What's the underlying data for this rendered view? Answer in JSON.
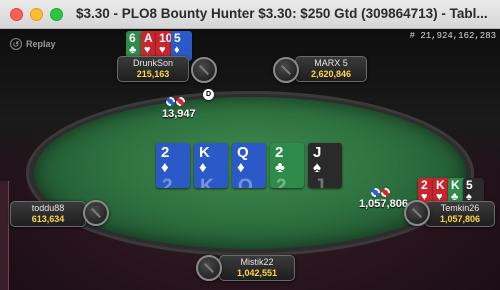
{
  "window": {
    "title": "$3.30 - PLO8 Bounty Hunter $3.30: $250 Gtd  (309864713) - Tabl..."
  },
  "toolbar": {
    "replay_label": "Replay",
    "hand_id": "# 21,924,162,283"
  },
  "players": {
    "top_left": {
      "name": "DrunkSon",
      "stack": "215,163"
    },
    "top_right": {
      "name": "MARX 5",
      "stack": "2,620,846"
    },
    "left": {
      "name": "toddu88",
      "stack": "613,634"
    },
    "right": {
      "name": "Temkin26",
      "stack": "1,057,806"
    },
    "bottom": {
      "name": "Mistik22",
      "stack": "1,042,551"
    }
  },
  "hole_cards": {
    "top_left": [
      {
        "rank": "6",
        "suit": "♣",
        "color": "#2e8b4a"
      },
      {
        "rank": "A",
        "suit": "♥",
        "color": "#c8262e"
      },
      {
        "rank": "10",
        "suit": "♥",
        "color": "#c8262e"
      },
      {
        "rank": "5",
        "suit": "♦",
        "color": "#2c59c8"
      }
    ],
    "right": [
      {
        "rank": "2",
        "suit": "♥",
        "color": "#c8262e"
      },
      {
        "rank": "K",
        "suit": "♥",
        "color": "#c8262e"
      },
      {
        "rank": "K",
        "suit": "♣",
        "color": "#2e8b4a"
      },
      {
        "rank": "5",
        "suit": "♠",
        "color": "#2a2a2a"
      }
    ]
  },
  "board": [
    {
      "rank": "2",
      "suit": "♦",
      "color": "#2c59c8"
    },
    {
      "rank": "K",
      "suit": "♦",
      "color": "#2c59c8"
    },
    {
      "rank": "Q",
      "suit": "♦",
      "color": "#2c59c8"
    },
    {
      "rank": "2",
      "suit": "♣",
      "color": "#2e8b4a"
    },
    {
      "rank": "J",
      "suit": "♠",
      "color": "#2a2a2a"
    }
  ],
  "bets": {
    "top": "13,947",
    "right": "1,057,806"
  },
  "dealer_button": "D",
  "colors": {
    "felt": "#2f7240",
    "chip_red": "#d4242c",
    "chip_blue": "#2a5fd0",
    "stack_text": "#ffd54a"
  }
}
